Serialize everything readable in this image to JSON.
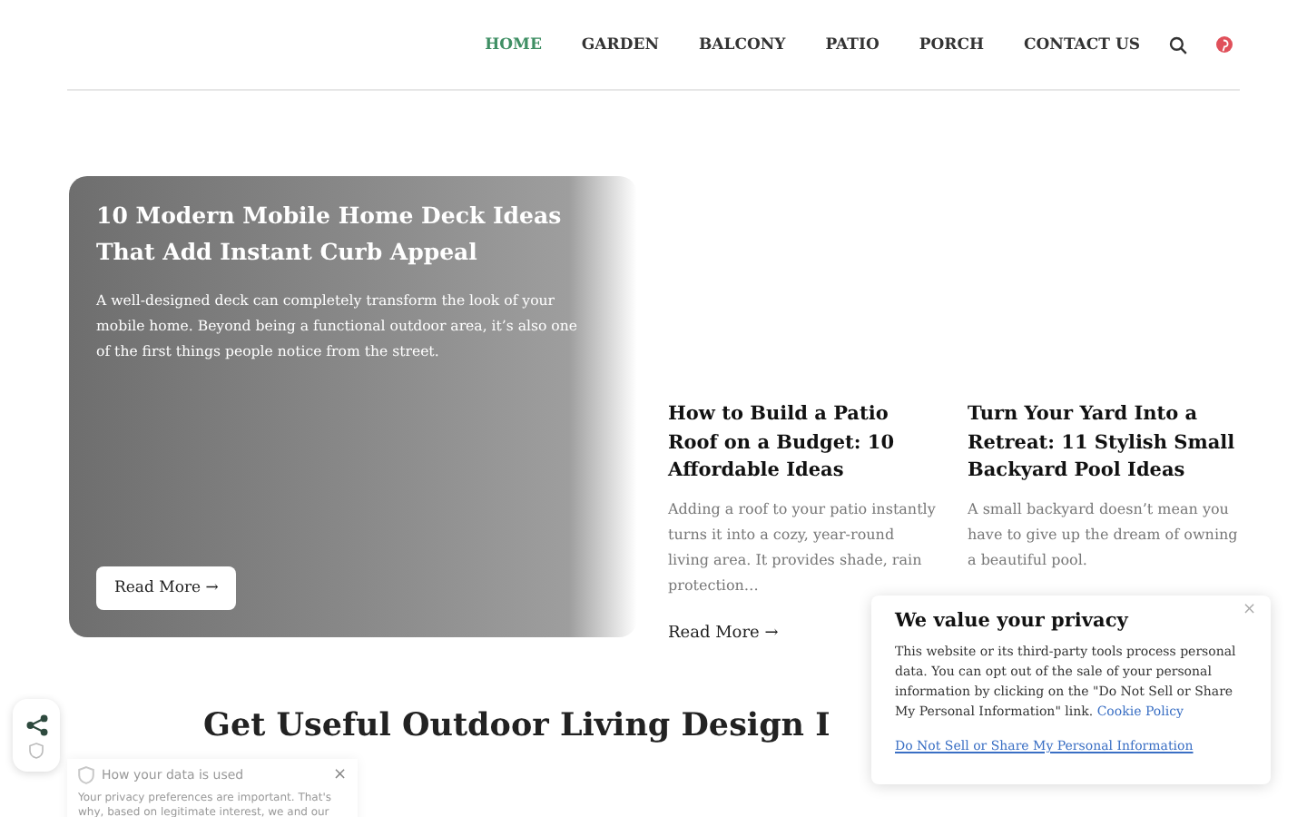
{
  "nav": {
    "items": [
      {
        "label": "HOME",
        "selected": true
      },
      {
        "label": "GARDEN",
        "selected": false
      },
      {
        "label": "BALCONY",
        "selected": false
      },
      {
        "label": "PATIO",
        "selected": false
      },
      {
        "label": "PORCH",
        "selected": false
      },
      {
        "label": "CONTACT US",
        "selected": false
      }
    ]
  },
  "featured": {
    "title": "10 Modern Mobile Home Deck Ideas That Add Instant Curb Appeal",
    "excerpt": "A well-designed deck can completely transform the look of your mobile home. Beyond being a functional outdoor area, it’s also one of the first things people notice from the street.",
    "button": "Read More →"
  },
  "posts": [
    {
      "title": "How to Build a Patio Roof on a Budget: 10 Affordable Ideas",
      "excerpt": "Adding a roof to your patio instantly turns it into a cozy, year-round living area. It provides shade, rain protection…",
      "link": "Read More →"
    },
    {
      "title": "Turn Your Yard Into a Retreat: 11 Stylish Small Backyard Pool Ideas",
      "excerpt": "A small backyard doesn’t mean you have to give up the dream of owning a beautiful pool."
    }
  ],
  "section_heading": "Get Useful Outdoor Living Design I",
  "privacy_popup": {
    "close": "×",
    "title": "We value your privacy",
    "text": "This website or its third-party tools process personal data. You can opt out of the sale of your personal information by clicking on the \"Do Not Sell or Share My Personal Information\" link.",
    "policy_link": "Cookie Policy",
    "opt_out_link": "Do Not Sell or Share My Personal Information"
  },
  "data_panel": {
    "title": "How your data is used",
    "close": "×",
    "text": "Your privacy preferences are important. That's why, based on legitimate interest, we and our"
  }
}
